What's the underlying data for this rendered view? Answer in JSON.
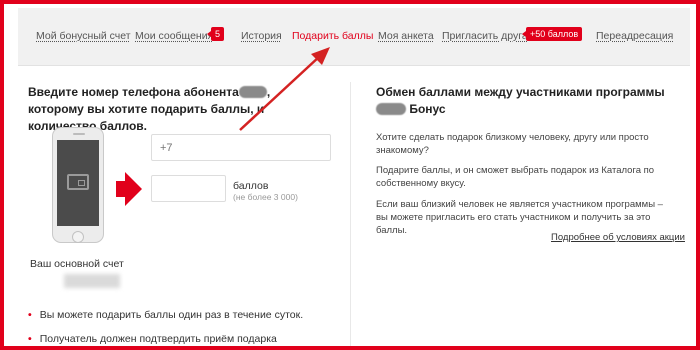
{
  "nav": {
    "items": [
      {
        "label": "Мой бонусный счет"
      },
      {
        "label": "Мои сообщения"
      },
      {
        "label": "История"
      },
      {
        "label": "Подарить баллы"
      },
      {
        "label": "Моя анкета"
      },
      {
        "label": "Пригласить друга"
      },
      {
        "label": "Переадресация"
      }
    ],
    "messages_badge": "5",
    "invite_badge": "+50 баллов",
    "active_color": "#e1001b"
  },
  "left": {
    "title_part1": "Введите номер телефона абонента",
    "title_part2": ", которому вы хотите подарить баллы, и количество баллов.",
    "phone_caption": "Ваш основной счет",
    "phone_input": {
      "placeholder": "+7",
      "value": ""
    },
    "points_input": {
      "placeholder": "",
      "value": ""
    },
    "points_label": "баллов",
    "points_note": "(не более 3 000)",
    "bullets": [
      "Вы можете подарить баллы один раз в течение суток.",
      "Получатель должен подтвердить приём подарка"
    ]
  },
  "right": {
    "title_part1": "Обмен баллами между участниками программы",
    "title_part2": "Бонус",
    "paragraphs": [
      "Хотите сделать подарок близкому человеку, другу или просто знакомому?",
      "Подарите баллы, и он сможет выбрать подарок из Каталога по собственному вкусу.",
      "Если ваш близкий человек не является участником программы – вы можете пригласить его стать участником и получить за это баллы."
    ],
    "more_link": "Подробнее об условиях акции"
  },
  "colors": {
    "frame": "#e1001b",
    "accent": "#e1001b",
    "nav_bg": "#f1f1f1"
  },
  "icons": {
    "phone": "smartphone-icon",
    "wallet": "wallet-icon",
    "arrow": "red-arrow-icon"
  }
}
